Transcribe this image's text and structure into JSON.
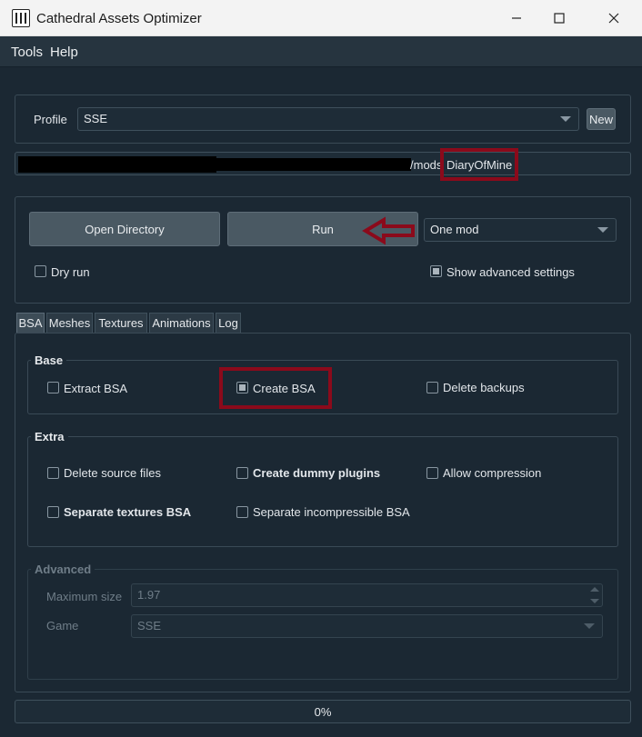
{
  "window": {
    "title": "Cathedral Assets Optimizer"
  },
  "menu": {
    "items": [
      "Tools",
      "Help"
    ]
  },
  "profile": {
    "label": "Profile",
    "value": "SSE",
    "new_label": "New"
  },
  "path": {
    "visible_fragment": "/mods",
    "highlighted": "DiaryOfMine"
  },
  "actions": {
    "open_directory_label": "Open Directory",
    "run_label": "Run",
    "mode_value": "One mod",
    "dry_run_label": "Dry run",
    "dry_run_checked": false,
    "show_advanced_label": "Show advanced settings",
    "show_advanced_checked": true
  },
  "tabs": [
    {
      "label": "BSA",
      "active": true
    },
    {
      "label": "Meshes",
      "active": false
    },
    {
      "label": "Textures",
      "active": false
    },
    {
      "label": "Animations",
      "active": false
    },
    {
      "label": "Log",
      "active": false
    }
  ],
  "base": {
    "title": "Base",
    "extract_bsa": "Extract BSA",
    "create_bsa": "Create BSA",
    "delete_backups": "Delete backups"
  },
  "extra": {
    "title": "Extra",
    "delete_source_files": "Delete source files",
    "create_dummy_plugins": "Create dummy plugins",
    "allow_compression": "Allow compression",
    "separate_textures_bsa": "Separate textures BSA",
    "separate_incompressible_bsa": "Separate incompressible BSA"
  },
  "advanced": {
    "title": "Advanced",
    "max_size_label": "Maximum size",
    "max_size_value": "1.97",
    "game_label": "Game",
    "game_value": "SSE"
  },
  "progress": {
    "text": "0%",
    "value": 0
  },
  "colors": {
    "background": "#1b2833",
    "annotation_red": "#8b0a1b",
    "titlebar": "#f3f3f3"
  }
}
